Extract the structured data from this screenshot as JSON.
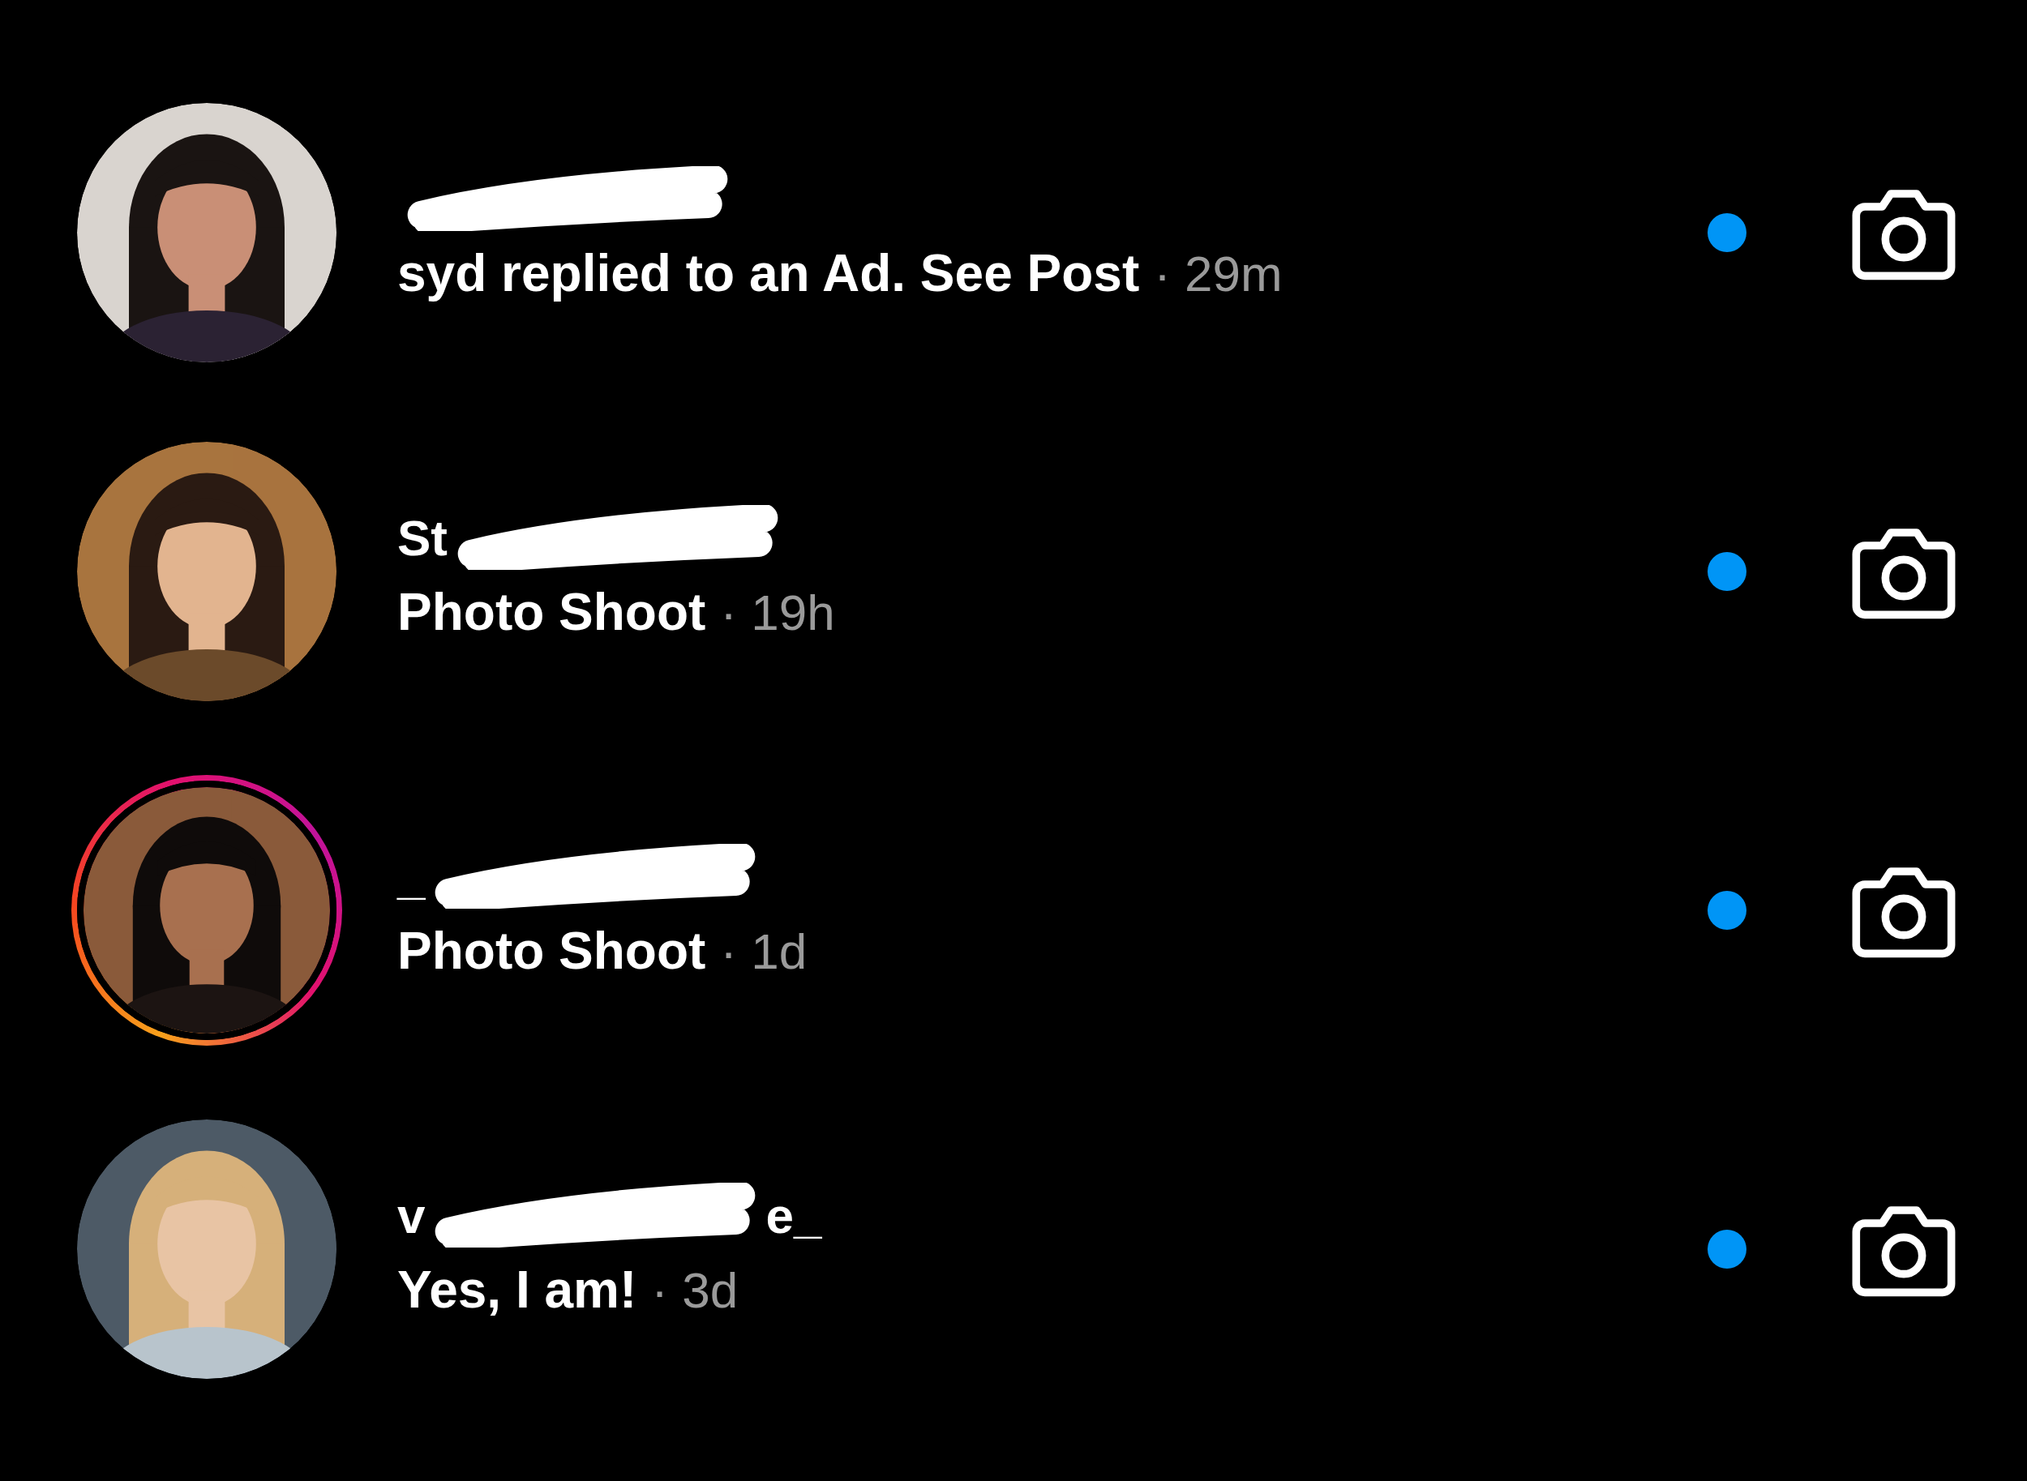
{
  "threads": [
    {
      "kind": "picture",
      "story_ring": false,
      "name_parts": [
        {
          "kind": "redaction"
        }
      ],
      "message": "syd replied to an Ad. See Post",
      "time": "· 29m",
      "unread": true
    },
    {
      "kind": "picture",
      "story_ring": false,
      "name_parts": [
        {
          "kind": "text",
          "text": "St"
        },
        {
          "kind": "redaction"
        }
      ],
      "message": "Photo Shoot",
      "time": "· 19h",
      "unread": true
    },
    {
      "kind": "picture",
      "story_ring": true,
      "name_parts": [
        {
          "kind": "text",
          "text": "_"
        },
        {
          "kind": "redaction"
        }
      ],
      "message": "Photo Shoot",
      "time": "· 1d",
      "unread": true
    },
    {
      "kind": "picture",
      "story_ring": false,
      "name_parts": [
        {
          "kind": "text",
          "text": "v"
        },
        {
          "kind": "redaction"
        },
        {
          "kind": "text",
          "text": "e_"
        }
      ],
      "message": "Yes, I am!",
      "time": "· 3d",
      "unread": true
    }
  ]
}
